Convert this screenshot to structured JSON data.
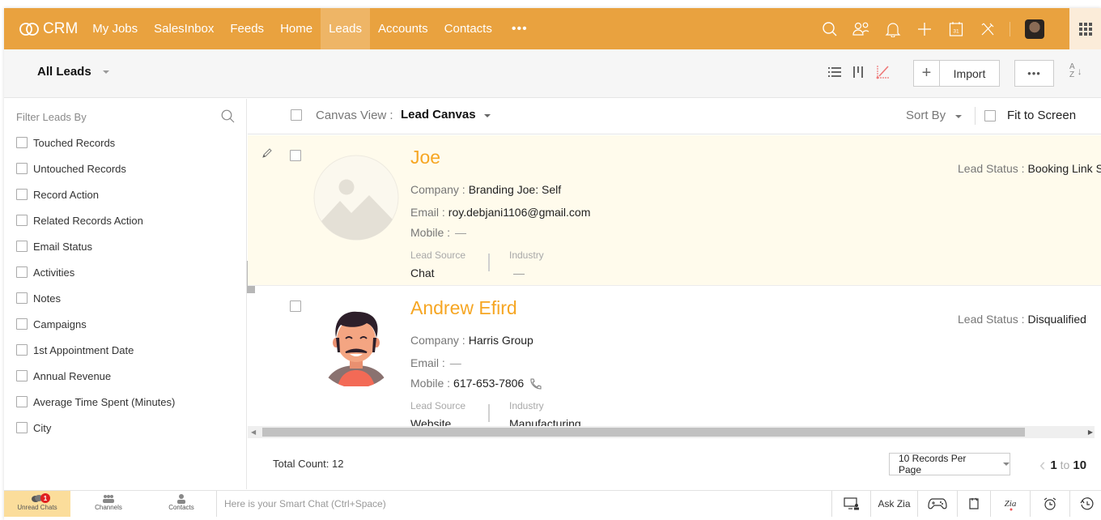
{
  "app": {
    "brand": "CRM",
    "accent_color": "#e9a23f",
    "name_color": "#f6a623"
  },
  "nav": {
    "items": [
      {
        "label": "My Jobs",
        "active": false
      },
      {
        "label": "SalesInbox",
        "active": false
      },
      {
        "label": "Feeds",
        "active": false
      },
      {
        "label": "Home",
        "active": false
      },
      {
        "label": "Leads",
        "active": true
      },
      {
        "label": "Accounts",
        "active": false
      },
      {
        "label": "Contacts",
        "active": false
      }
    ],
    "more_label": "•••",
    "icons": [
      "search-icon",
      "contacts-sync-icon",
      "bell-icon",
      "plus-icon",
      "calendar-icon",
      "tools-icon",
      "user-avatar",
      "apps-grid-icon"
    ],
    "calendar_day": "31"
  },
  "subheader": {
    "view_name": "All Leads",
    "view_icons": [
      "list-view-icon",
      "kanban-view-icon",
      "canvas-view-icon"
    ],
    "plus_label": "+",
    "import_label": "Import",
    "more_label": "•••",
    "sort_label_top": "A",
    "sort_label_bottom": "Z"
  },
  "filters": {
    "title": "Filter Leads By",
    "items": [
      "Touched Records",
      "Untouched Records",
      "Record Action",
      "Related Records Action",
      "Email Status",
      "Activities",
      "Notes",
      "Campaigns",
      "1st Appointment Date",
      "Annual Revenue",
      "Average Time Spent (Minutes)",
      "City"
    ]
  },
  "canvas": {
    "view_label": "Canvas View :",
    "view_value": "Lead Canvas",
    "sort_by_label": "Sort By",
    "fit_to_screen_label": "Fit to Screen"
  },
  "labels": {
    "company": "Company :",
    "email": "Email :",
    "mobile": "Mobile :",
    "lead_source": "Lead Source",
    "industry": "Industry",
    "lead_status": "Lead Status :"
  },
  "records": [
    {
      "name": "Joe",
      "company": "Branding Joe: Self",
      "email": "roy.debjani1106@gmail.com",
      "mobile": "—",
      "lead_source": "Chat",
      "industry": "—",
      "lead_status": "Booking Link S",
      "highlighted": true,
      "photo": "placeholder-image"
    },
    {
      "name": "Andrew Efird",
      "company": "Harris Group",
      "email": "—",
      "mobile": "617-653-7806",
      "lead_source": "Website",
      "industry": "Manufacturing",
      "lead_status": "Disqualified",
      "highlighted": false,
      "photo": "cartoon-avatar"
    }
  ],
  "footer": {
    "total_count_label": "Total Count:",
    "total_count": "12",
    "per_page": "10 Records Per Page",
    "page_from": "1",
    "page_to_word": "to",
    "page_to": "10"
  },
  "bottombar": {
    "tabs": [
      {
        "label": "Unread Chats",
        "badge": "1",
        "active": true
      },
      {
        "label": "Channels",
        "active": false
      },
      {
        "label": "Contacts",
        "active": false
      }
    ],
    "smart_chat_placeholder": "Here is your Smart Chat (Ctrl+Space)",
    "ask_zia": "Ask Zia",
    "tool_icons": [
      "screen-share-icon",
      "ask-zia",
      "game-controller-icon",
      "notes-icon",
      "zia-icon",
      "alarm-icon",
      "history-icon"
    ]
  }
}
